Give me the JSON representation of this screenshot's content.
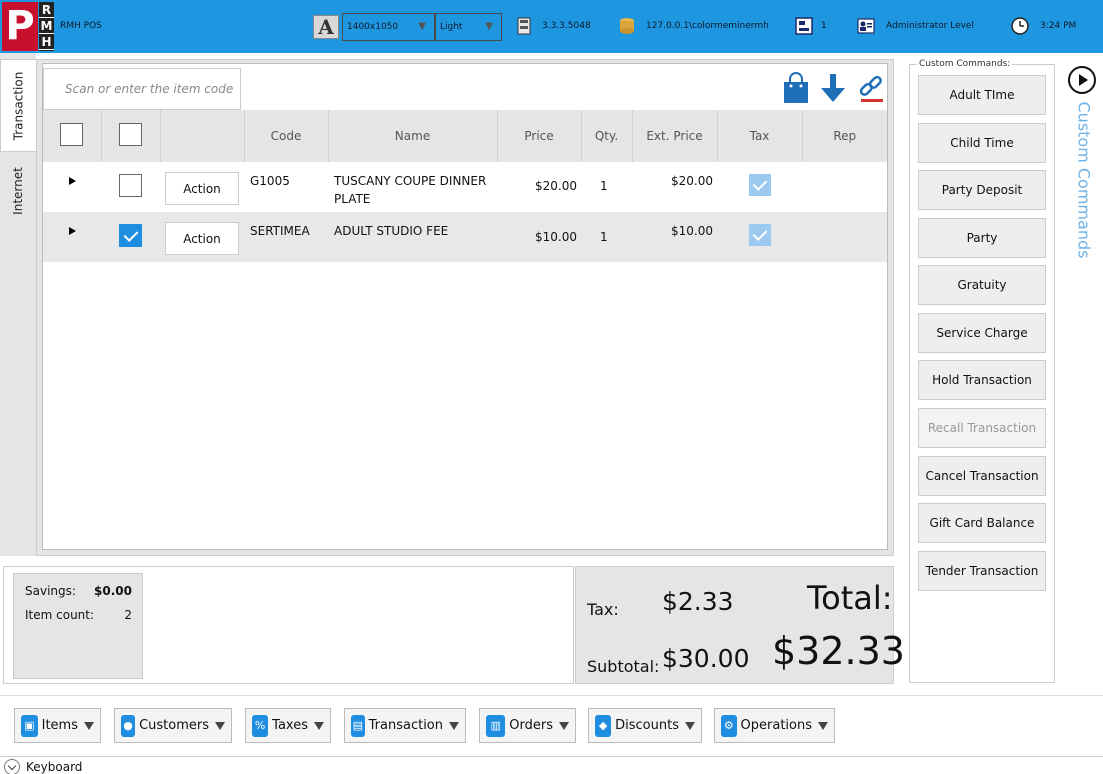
{
  "topbar": {
    "app_name": "RMH POS",
    "logo_letters": [
      "R",
      "M",
      "H"
    ],
    "logo_p": "P",
    "font_icon": "A",
    "resolution": "1400x1050",
    "theme": "Light",
    "version": "3.3.3.5048",
    "database": "127.0.0.1\\colormeminermh",
    "register": "1",
    "user_level": "Administrator Level",
    "time": "3:24 PM",
    "icons": [
      "font-icon",
      "version-icon",
      "database-icon",
      "register-icon",
      "user-icon",
      "clock-icon"
    ]
  },
  "tabs": {
    "transaction": "Transaction",
    "internet": "Internet"
  },
  "scan": {
    "placeholder": "Scan or enter the item code"
  },
  "grid": {
    "headers": [
      "",
      "",
      "",
      "Code",
      "Name",
      "Price",
      "Qty.",
      "Ext. Price",
      "Tax",
      "Rep"
    ],
    "rows": [
      {
        "checked": false,
        "action": "Action",
        "code": "G1005",
        "name": "TUSCANY COUPE DINNER PLATE",
        "price": "$20.00",
        "qty": "1",
        "ext_price": "$20.00",
        "tax": true,
        "rep": ""
      },
      {
        "checked": true,
        "action": "Action",
        "code": "SERTIMEA",
        "name": "ADULT STUDIO FEE",
        "price": "$10.00",
        "qty": "1",
        "ext_price": "$10.00",
        "tax": true,
        "rep": ""
      }
    ]
  },
  "summary": {
    "savings_label": "Savings:",
    "savings_value": "$0.00",
    "item_count_label": "Item count:",
    "item_count_value": "2",
    "tax_label": "Tax:",
    "tax_value": "$2.33",
    "subtotal_label": "Subtotal:",
    "subtotal_value": "$30.00",
    "total_label": "Total:",
    "total_value": "$32.33"
  },
  "custom_commands": {
    "title": "Custom Commands:",
    "vertical_label": "Custom Commands",
    "buttons": [
      {
        "label": "Adult TIme",
        "enabled": true
      },
      {
        "label": "Child Time",
        "enabled": true
      },
      {
        "label": "Party Deposit",
        "enabled": true
      },
      {
        "label": "Party",
        "enabled": true
      },
      {
        "label": "Gratuity",
        "enabled": true
      },
      {
        "label": "Service Charge",
        "enabled": true
      },
      {
        "label": "Hold Transaction",
        "enabled": true
      },
      {
        "label": "Recall Transaction",
        "enabled": false
      },
      {
        "label": "Cancel Transaction",
        "enabled": true
      },
      {
        "label": "Gift Card Balance",
        "enabled": true
      },
      {
        "label": "Tender Transaction",
        "enabled": true
      }
    ]
  },
  "ribbon": {
    "items": "Items",
    "customers": "Customers",
    "taxes": "Taxes",
    "transaction": "Transaction",
    "orders": "Orders",
    "discounts": "Discounts",
    "operations": "Operations"
  },
  "keyboard": {
    "label": "Keyboard"
  },
  "colors": {
    "accent": "#1f97e0",
    "logo_red": "#c8102e",
    "check_blue": "#1f8ee0"
  }
}
